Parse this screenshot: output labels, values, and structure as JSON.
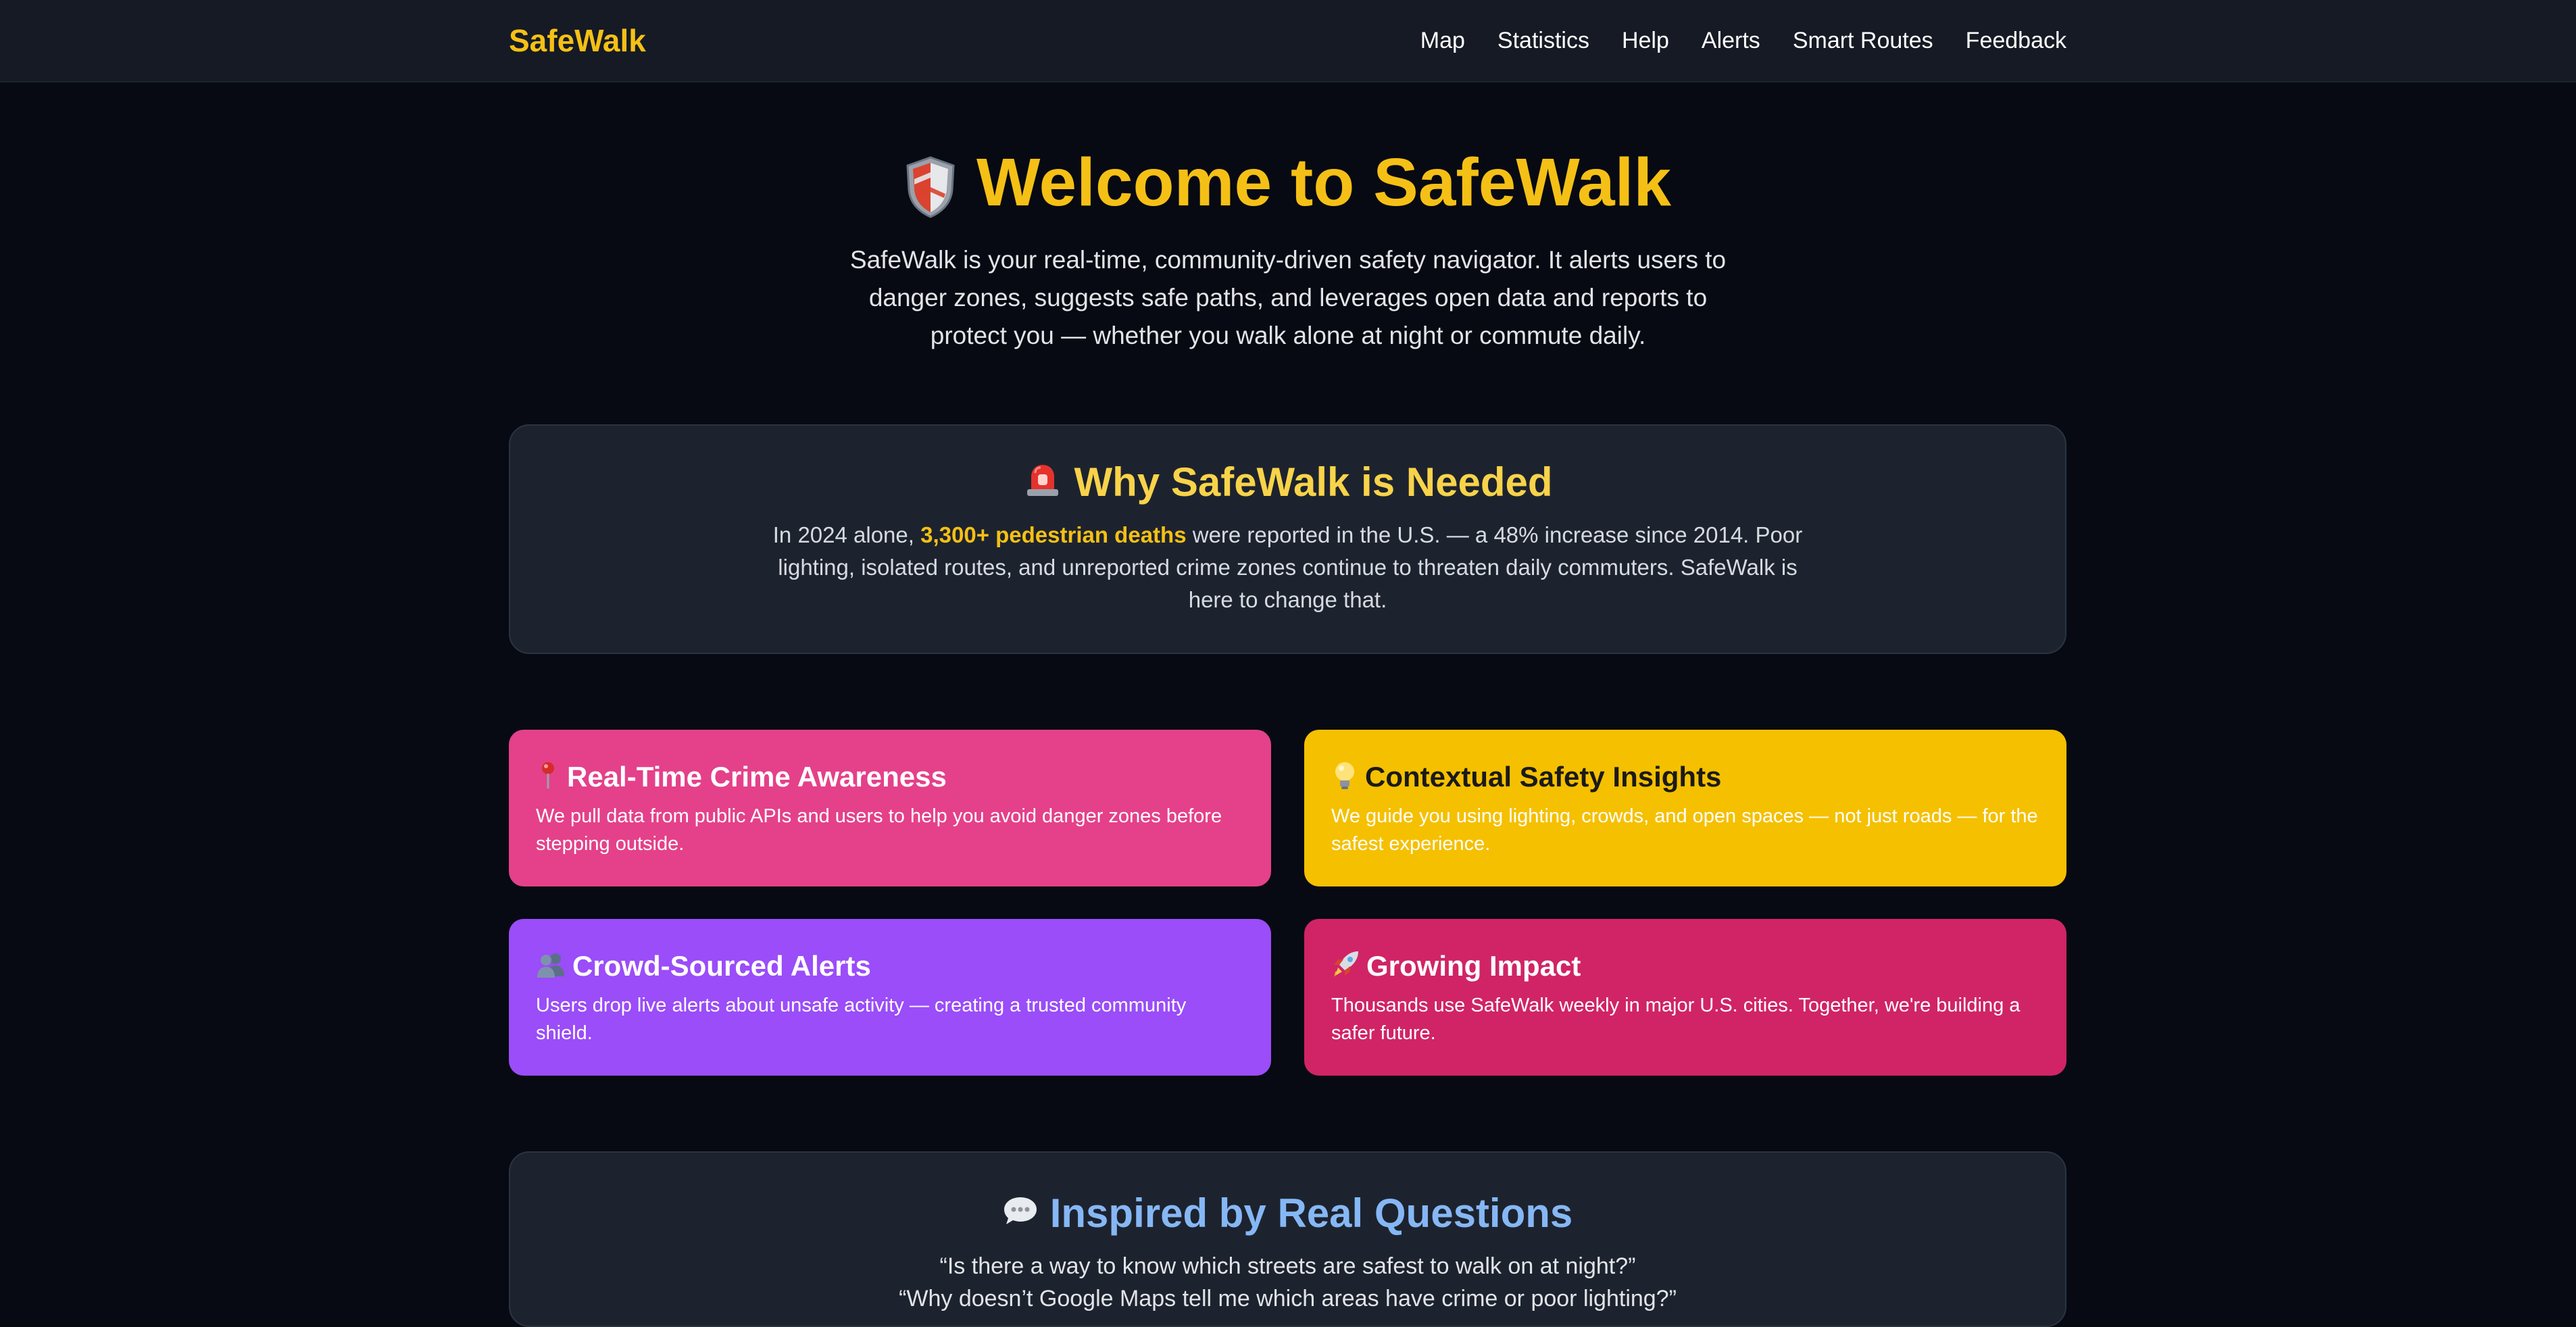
{
  "nav": {
    "brand": "SafeWalk",
    "links": [
      "Map",
      "Statistics",
      "Help",
      "Alerts",
      "Smart Routes",
      "Feedback"
    ]
  },
  "hero": {
    "icon": "shield-icon",
    "title": "Welcome to SafeWalk",
    "description": "SafeWalk is your real-time, community-driven safety navigator. It alerts users to danger zones, suggests safe paths, and leverages open data and reports to protect you — whether you walk alone at night or commute daily."
  },
  "why": {
    "icon": "siren-icon",
    "title": "Why SafeWalk is Needed",
    "body_prefix": "In 2024 alone, ",
    "body_highlight": "3,300+ pedestrian deaths",
    "body_suffix": " were reported in the U.S. — a 48% increase since 2014. Poor lighting, isolated routes, and unreported crime zones continue to threaten daily commuters. SafeWalk is here to change that."
  },
  "features": [
    {
      "icon": "pin-icon",
      "title": "Real-Time Crime Awareness",
      "body": "We pull data from public APIs and users to help you avoid danger zones before stepping outside."
    },
    {
      "icon": "lightbulb-icon",
      "title": "Contextual Safety Insights",
      "body": "We guide you using lighting, crowds, and open spaces — not just roads — for the safest experience."
    },
    {
      "icon": "people-icon",
      "title": "Crowd-Sourced Alerts",
      "body": "Users drop live alerts about unsafe activity — creating a trusted community shield."
    },
    {
      "icon": "rocket-icon",
      "title": "Growing Impact",
      "body": "Thousands use SafeWalk weekly in major U.S. cities. Together, we're building a safer future."
    }
  ],
  "quotes": {
    "icon": "speech-bubble-icon",
    "title": "Inspired by Real Questions",
    "items": [
      "“Is there a way to know which streets are safest to walk on at night?”",
      "“Why doesn’t Google Maps tell me which areas have crime or poor lighting?”"
    ]
  },
  "colors": {
    "accent": "#f5c016",
    "background": "#070a12",
    "nav_bg": "#151a24",
    "card_bg": "#1d232e",
    "feature_pink": "#e4418a",
    "feature_yellow": "#f5c000",
    "feature_purple": "#9a4df8",
    "feature_crimson": "#d02466",
    "quotes_title": "#86b7f5"
  }
}
